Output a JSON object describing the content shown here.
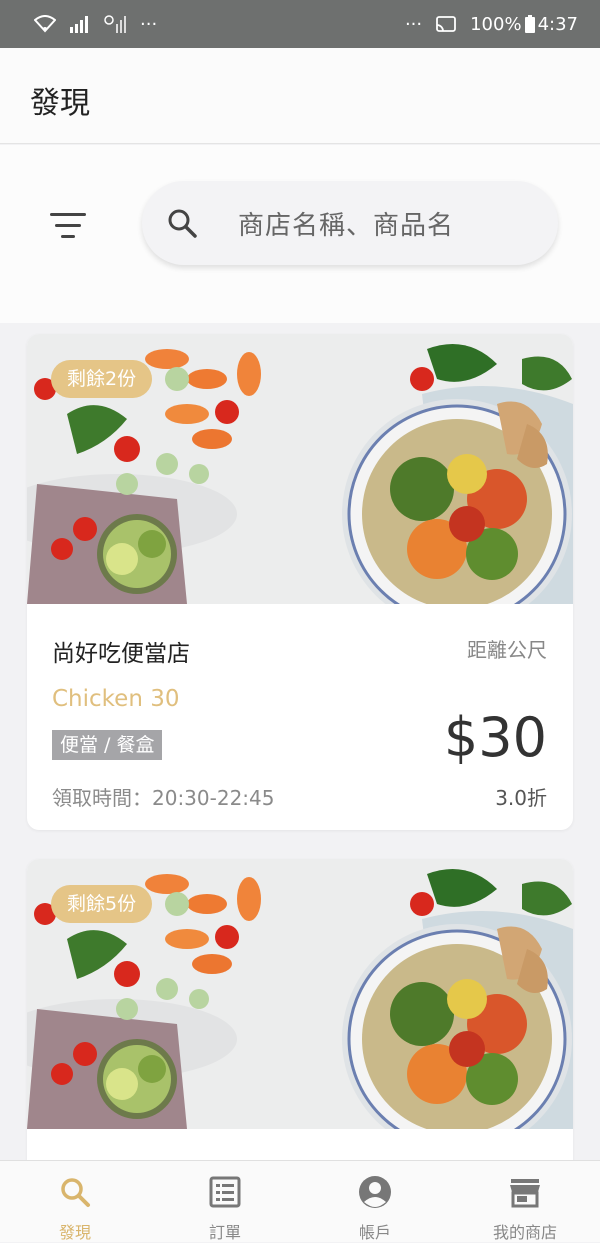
{
  "status_bar": {
    "left_dots": "···",
    "right_dots": "···",
    "battery": "100%",
    "time": "4:37"
  },
  "header": {
    "title": "發現"
  },
  "search": {
    "placeholder": "商店名稱、商品名"
  },
  "cards": [
    {
      "badge": "剩餘2份",
      "store_name": "尚好吃便當店",
      "distance": "距離公尺",
      "product": "Chicken 30",
      "category": "便當 / 餐盒",
      "price": "$30",
      "pickup_time": "領取時間：20:30-22:45",
      "discount": "3.0折"
    },
    {
      "badge": "剩餘5份"
    }
  ],
  "bottom_nav": [
    {
      "label": "發現",
      "icon": "search-icon",
      "active": true
    },
    {
      "label": "訂單",
      "icon": "order-list-icon",
      "active": false
    },
    {
      "label": "帳戶",
      "icon": "account-icon",
      "active": false
    },
    {
      "label": "我的商店",
      "icon": "store-icon",
      "active": false
    }
  ],
  "colors": {
    "accent": "#d9b56c",
    "badge": "#e5c587",
    "status_bar": "#6e706f"
  }
}
